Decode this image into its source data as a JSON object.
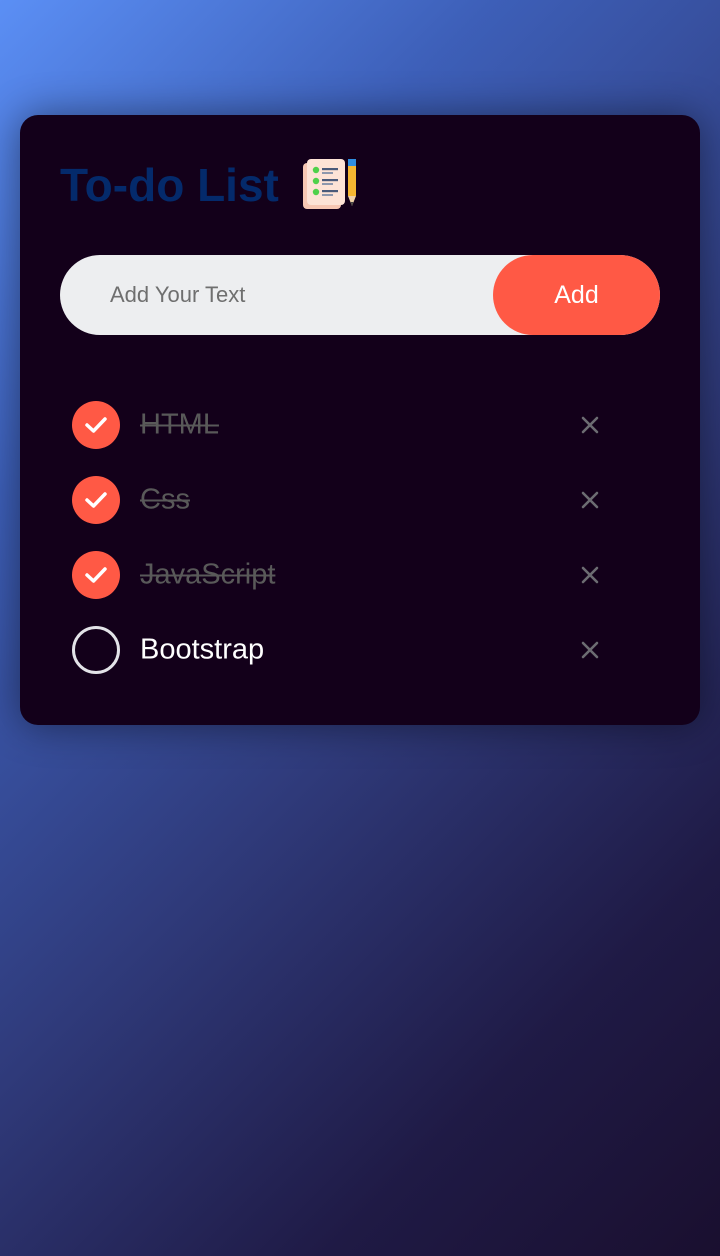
{
  "app": {
    "title": "To-do List",
    "title_icon": "notepad-checklist-icon"
  },
  "input": {
    "placeholder": "Add Your Text",
    "value": ""
  },
  "add_button": {
    "label": "Add"
  },
  "colors": {
    "accent": "#ff5945",
    "card_bg": "#13001a",
    "title": "#042a6b",
    "done_text": "#595959",
    "input_bg": "#edeef0"
  },
  "tasks": [
    {
      "label": "HTML",
      "done": true
    },
    {
      "label": "Css",
      "done": true
    },
    {
      "label": "JavaScript",
      "done": true
    },
    {
      "label": "Bootstrap",
      "done": false
    }
  ]
}
